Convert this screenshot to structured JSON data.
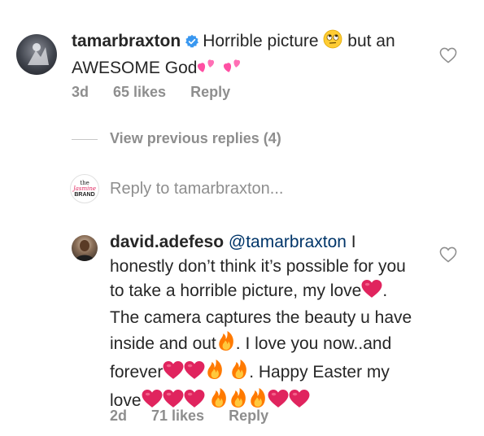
{
  "comments": [
    {
      "username": "tamarbraxton",
      "text_part1": "Horrible picture",
      "text_part2": " but an AWESOME God",
      "time": "3d",
      "likes": "65 likes",
      "reply_label": "Reply"
    },
    {
      "username": "david.adefeso",
      "mention": "@tamarbraxton",
      "text_part1": " I honestly don’t think it’s possible for you to take a horrible picture, my love",
      "text_part2": ". The camera captures the beauty u have inside and out",
      "text_part3": ". I love you now..and forever",
      "text_part4": ". Happy Easter my love",
      "time": "2d",
      "likes": "71 likes",
      "reply_label": "Reply"
    }
  ],
  "view_previous_replies": "View previous replies (4)",
  "reply_prompt": "Reply to tamarbraxton...",
  "brand_logo": {
    "line1": "the",
    "line2": "Jasmine",
    "line3": "BRAND"
  },
  "colors": {
    "text": "#262626",
    "secondary": "#8e8e8e",
    "verified": "#3897f0",
    "heart": "#e0245e",
    "pink_heart": "#ff4fa3",
    "fire": "#ff7a00",
    "mention": "#003569"
  },
  "icons": [
    "verified-badge-icon",
    "eye-roll-emoji-icon",
    "two-hearts-emoji-icon",
    "red-heart-emoji-icon",
    "fire-emoji-icon",
    "like-heart-icon"
  ]
}
